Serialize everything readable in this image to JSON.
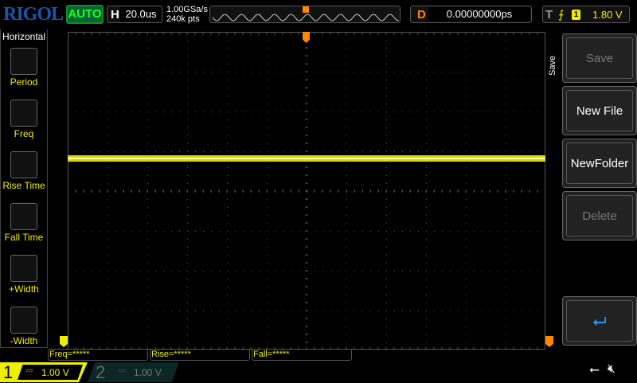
{
  "header": {
    "logo": "RIGOL",
    "mode": "AUTO",
    "h_label": "H",
    "timebase": "20.0us",
    "sample_rate": "1.00GSa/s",
    "memory_depth": "240k pts",
    "d_label": "D",
    "delay": "0.00000000ps",
    "t_label": "T",
    "trigger_edge": "rising-edge-icon",
    "trigger_source": "1",
    "trigger_level": "1.80 V"
  },
  "sidebar": {
    "title": "Horizontal",
    "items": [
      {
        "label": "Period",
        "icon": "period-icon"
      },
      {
        "label": "Freq",
        "icon": "freq-icon"
      },
      {
        "label": "Rise Time",
        "icon": "rise-time-icon"
      },
      {
        "label": "Fall Time",
        "icon": "fall-time-icon"
      },
      {
        "label": "+Width",
        "icon": "pos-width-icon"
      },
      {
        "label": "-Width",
        "icon": "neg-width-icon"
      }
    ]
  },
  "menu": {
    "title": "Save",
    "buttons": [
      {
        "label": "Save",
        "enabled": false
      },
      {
        "label": "New File",
        "enabled": true
      },
      {
        "label": "NewFolder",
        "enabled": true
      },
      {
        "label": "Delete",
        "enabled": false
      }
    ],
    "back_icon": "return-icon"
  },
  "measurements": [
    {
      "label": "Freq=*****"
    },
    {
      "label": "Rise=*****"
    },
    {
      "label": "Fall=*****"
    }
  ],
  "channels": [
    {
      "num": "1",
      "coupling": "DC",
      "scale": "1.00 V",
      "color": "#eeee00"
    },
    {
      "num": "2",
      "coupling": "DC",
      "scale": "1.00 V",
      "color": "#888888"
    }
  ],
  "status": {
    "usb": "usb-icon",
    "sound": "sound-muted-icon"
  },
  "colors": {
    "ch1": "#eeee00",
    "trigger": "#ff8800",
    "accent": "#22ff22"
  }
}
